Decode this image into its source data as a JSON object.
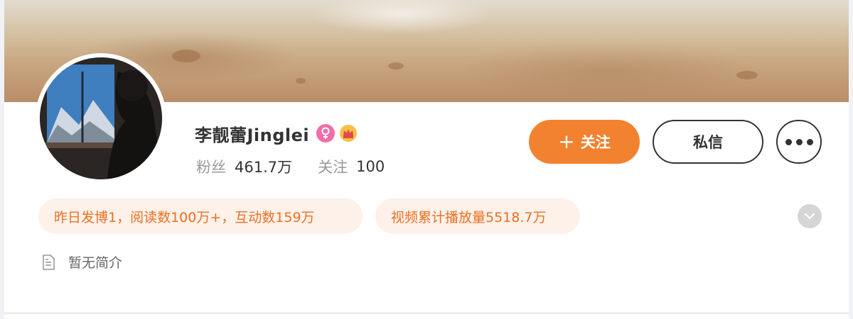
{
  "profile": {
    "name": "李靓蕾Jinglei",
    "gender_badge_icon": "female-icon",
    "vip_badge_icon": "crown-icon",
    "followers_label": "粉丝",
    "followers_value": "461.7万",
    "following_label": "关注",
    "following_value": "100"
  },
  "actions": {
    "follow_plus": "+",
    "follow_label": "关注",
    "message_label": "私信",
    "more_icon": "more-dots-icon"
  },
  "tags": [
    "昨日发博1，阅读数100万+，互动数159万",
    "视频累计播放量5518.7万"
  ],
  "intro": {
    "icon": "document-icon",
    "text": "暂无简介"
  },
  "colors": {
    "accent": "#f28230",
    "tag_bg": "#fdf1ea",
    "tag_text": "#eb7022",
    "female_badge": "#f06ea9"
  }
}
